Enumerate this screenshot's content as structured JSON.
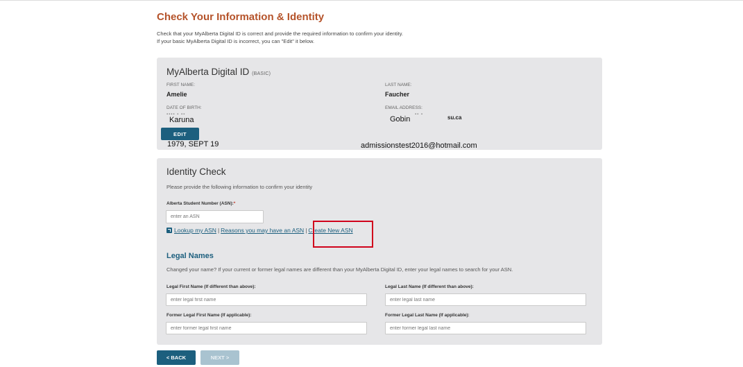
{
  "page": {
    "title": "Check Your Information & Identity",
    "intro_line1": "Check that your MyAlberta Digital ID is correct and provide the required information to confirm your identity.",
    "intro_line2": "If your basic MyAlberta Digital ID is incorrect, you can \"Edit\" it below."
  },
  "digital_id": {
    "heading": "MyAlberta Digital ID",
    "heading_tag": "(BASIC)",
    "first_name_label": "FIRST NAME:",
    "first_name_value": "Amelie",
    "last_name_label": "LAST NAME:",
    "last_name_value": "Faucher",
    "dob_label": "DATE OF BIRTH:",
    "email_label": "EMAIL ADDRESS:",
    "overlay_first": "Karuna",
    "overlay_last": "Gobin",
    "email_partial": "su.ca",
    "overlay_dob": "1979, SEPT 19",
    "overlay_email": "admissionstest2016@hotmail.com",
    "edit_button": "EDIT"
  },
  "identity_check": {
    "heading": "Identity Check",
    "description": "Please provide the following information to confirm your identity",
    "asn_label": "Alberta Student Number (ASN):",
    "asn_required": "*",
    "asn_placeholder": "enter an ASN",
    "link_lookup": "Lookup my ASN",
    "link_reasons": "Reasons you may have an ASN",
    "link_create": "Create New ASN",
    "separator": "|"
  },
  "legal_names": {
    "heading": "Legal Names",
    "description": "Changed your name? If your current or former legal names are different than your MyAlberta Digital ID, enter your legal names to search for your ASN.",
    "first_label": "Legal First Name (If different than above):",
    "first_placeholder": "enter legal first name",
    "last_label": "Legal Last Name (If different than above):",
    "last_placeholder": "enter legal last name",
    "former_first_label": "Former Legal First Name (If applicable):",
    "former_first_placeholder": "enter former legal first name",
    "former_last_label": "Former Legal Last Name (If applicable):",
    "former_last_placeholder": "enter former legal last name"
  },
  "nav": {
    "back": "< BACK",
    "next": "NEXT >"
  },
  "colors": {
    "title": "#b5532a",
    "accent": "#1c5f7e",
    "panel": "#e6e6e8",
    "highlight": "#d0021b"
  }
}
